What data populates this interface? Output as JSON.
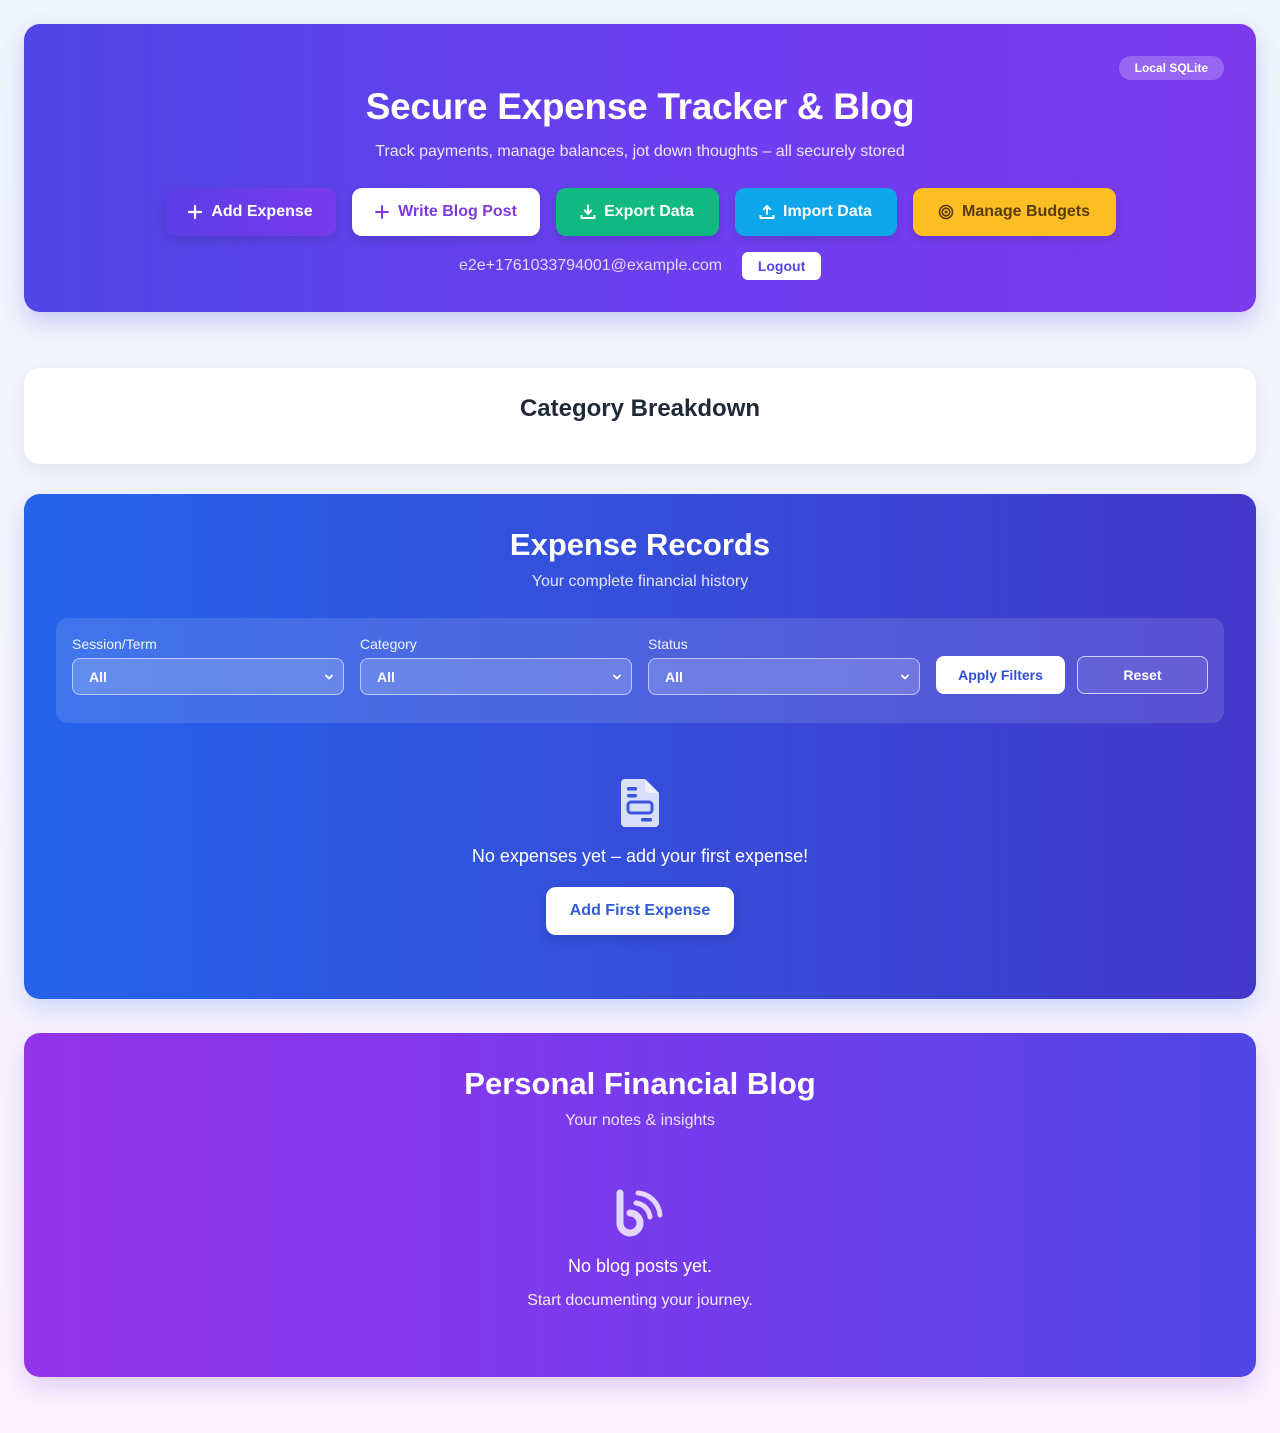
{
  "header": {
    "storage_badge": "Local SQLite",
    "title": "Secure Expense Tracker & Blog",
    "subtitle": "Track payments, manage balances, jot down thoughts – all securely stored",
    "actions": {
      "add_expense": "Add Expense",
      "write_blog": "Write Blog Post",
      "export": "Export Data",
      "import": "Import Data",
      "budgets": "Manage Budgets"
    },
    "user_email": "e2e+1761033794001@example.com",
    "logout": "Logout"
  },
  "breakdown": {
    "title": "Category Breakdown"
  },
  "expenses": {
    "title": "Expense Records",
    "subtitle": "Your complete financial history",
    "filters": {
      "session": {
        "label": "Session/Term",
        "value": "All"
      },
      "category": {
        "label": "Category",
        "value": "All"
      },
      "status": {
        "label": "Status",
        "value": "All"
      },
      "apply": "Apply Filters",
      "reset": "Reset"
    },
    "empty_text": "No expenses yet – add your first expense!",
    "empty_button": "Add First Expense"
  },
  "blog": {
    "title": "Personal Financial Blog",
    "subtitle": "Your notes & insights",
    "empty_title": "No blog posts yet.",
    "empty_sub": "Start documenting your journey."
  },
  "icons": {
    "add": "plus-icon",
    "write": "plus-icon",
    "export": "download-icon",
    "import": "upload-icon",
    "budgets": "target-icon",
    "select": "chevron-down-icon",
    "empty_expenses": "file-invoice-icon",
    "empty_blog": "blog-feed-icon"
  },
  "colors": {
    "header_gradient": [
      "#4f46e5",
      "#7c3aed"
    ],
    "expense_gradient": [
      "#2563eb",
      "#4338ca"
    ],
    "blog_gradient": [
      "#9333ea",
      "#4f46e5"
    ],
    "export": "#10b981",
    "import": "#0ea5e9",
    "budgets": "#fbbf24"
  }
}
